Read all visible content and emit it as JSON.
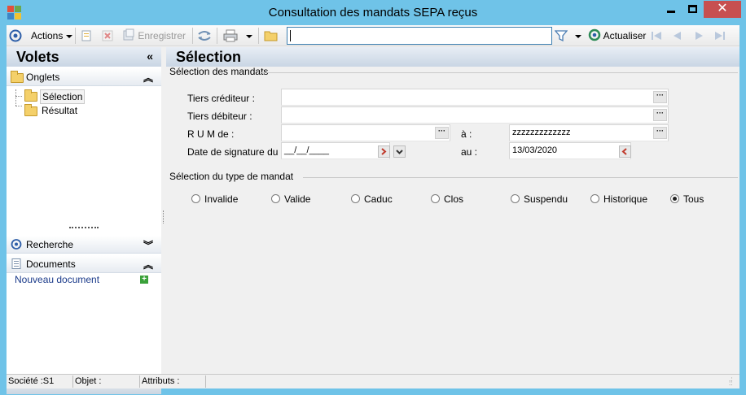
{
  "window": {
    "title": "Consultation des mandats SEPA reçus"
  },
  "toolbar": {
    "actions_label": "Actions",
    "save_label": "Enregistrer",
    "search_value": "",
    "refresh_label": "Actualiser"
  },
  "left_panel": {
    "title": "Volets",
    "onglets": {
      "label": "Onglets",
      "items": [
        {
          "label": "Sélection"
        },
        {
          "label": "Résultat"
        }
      ]
    },
    "recherche_label": "Recherche",
    "documents": {
      "label": "Documents",
      "new_doc_link": "Nouveau document"
    }
  },
  "main": {
    "title": "Sélection",
    "mandats_group": "Sélection des mandats",
    "fields": {
      "tiers_crediteur": {
        "label": "Tiers créditeur :",
        "value": ""
      },
      "tiers_debiteur": {
        "label": "Tiers débiteur :",
        "value": ""
      },
      "rum_de": {
        "label": "R U M de  :",
        "value": ""
      },
      "rum_a": {
        "label": "à :",
        "value": "zzzzzzzzzzzzz"
      },
      "date_du": {
        "label": "Date de signature du :",
        "value": "__/__/____"
      },
      "date_au": {
        "label": "au :",
        "value": "13/03/2020"
      }
    },
    "type_group": "Sélection du type de mandat",
    "mandate_types": [
      {
        "label": "Invalide",
        "checked": false
      },
      {
        "label": "Valide",
        "checked": false
      },
      {
        "label": "Caduc",
        "checked": false
      },
      {
        "label": "Clos",
        "checked": false
      },
      {
        "label": "Suspendu",
        "checked": false
      },
      {
        "label": "Historique",
        "checked": false
      },
      {
        "label": "Tous",
        "checked": true
      }
    ]
  },
  "status_bar": {
    "societe": "Société :S1",
    "objet": "Objet :",
    "attributs": "Attributs :"
  }
}
